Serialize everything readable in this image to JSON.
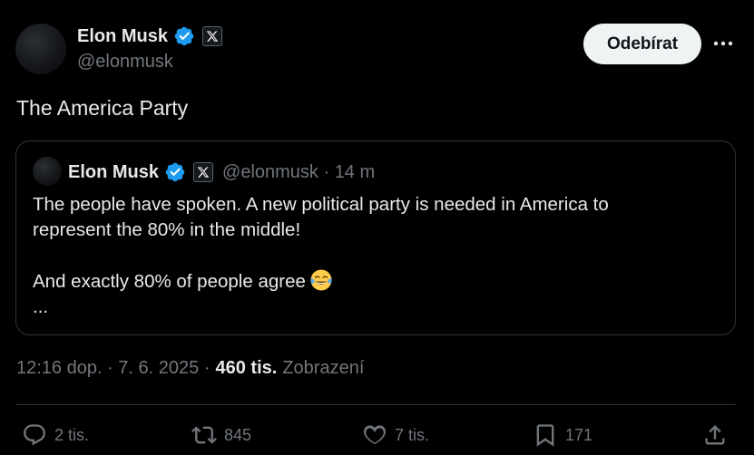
{
  "author": {
    "display_name": "Elon Musk",
    "handle": "@elonmusk",
    "verified_color": "#1d9bf0"
  },
  "header": {
    "follow_label": "Odebírat"
  },
  "tweet": {
    "text": "The America Party"
  },
  "quoted": {
    "display_name": "Elon Musk",
    "handle_time": "@elonmusk · 14 m",
    "line1": "The people have spoken. A new political party is needed in America to",
    "line2": "represent the 80% in the middle!",
    "line3": "And exactly 80% of people agree",
    "line4": "..."
  },
  "meta": {
    "time_date": "12:16 dop. · 7. 6. 2025 ·",
    "views_count": "460 tis.",
    "views_label": "Zobrazení"
  },
  "actions": {
    "replies": "2 tis.",
    "reposts": "845",
    "likes": "7 tis.",
    "bookmarks": "171"
  },
  "icons": [
    "verified-badge-icon",
    "x-affiliation-icon",
    "more-icon",
    "tears-of-joy-emoji-icon",
    "reply-icon",
    "repost-icon",
    "like-icon",
    "bookmark-icon",
    "share-icon"
  ],
  "colors": {
    "background": "#000000",
    "text": "#e7e9ea",
    "muted": "#71767b",
    "border": "#2f3336",
    "follow_bg": "#eff3f4"
  }
}
